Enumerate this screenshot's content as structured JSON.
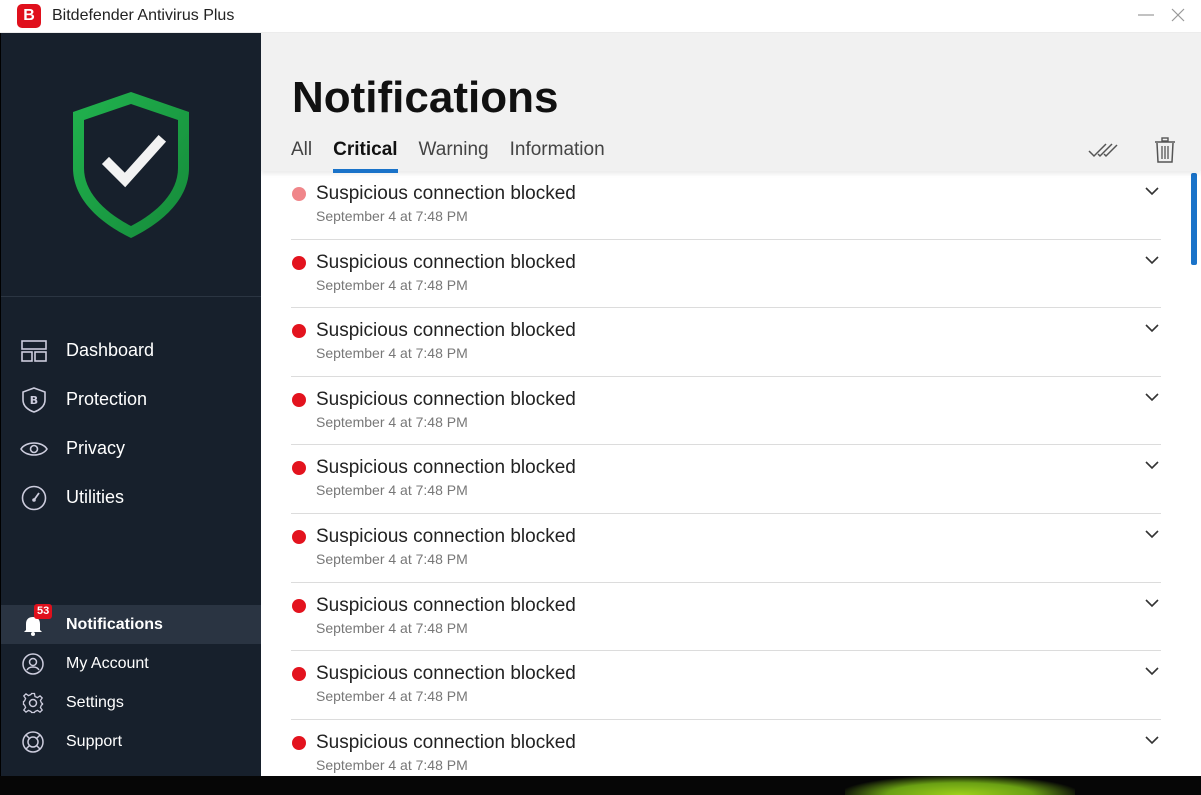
{
  "window": {
    "title": "Bitdefender Antivirus Plus",
    "logo_letter": "B",
    "minimize": "—",
    "close": "✕"
  },
  "sidebar": {
    "main_nav": [
      {
        "label": "Dashboard",
        "icon": "dashboard-icon"
      },
      {
        "label": "Protection",
        "icon": "shield-b-icon"
      },
      {
        "label": "Privacy",
        "icon": "eye-icon"
      },
      {
        "label": "Utilities",
        "icon": "gauge-icon"
      }
    ],
    "secondary_nav": [
      {
        "label": "Notifications",
        "icon": "bell-icon",
        "badge": "53",
        "active": true
      },
      {
        "label": "My Account",
        "icon": "user-icon"
      },
      {
        "label": "Settings",
        "icon": "gear-icon"
      },
      {
        "label": "Support",
        "icon": "lifebuoy-icon"
      }
    ]
  },
  "main": {
    "title": "Notifications",
    "tabs": [
      {
        "label": "All"
      },
      {
        "label": "Critical",
        "active": true
      },
      {
        "label": "Warning"
      },
      {
        "label": "Information"
      }
    ],
    "notifications": [
      {
        "title": "Suspicious connection blocked",
        "time": "September 4 at 7:48 PM",
        "read": true
      },
      {
        "title": "Suspicious connection blocked",
        "time": "September 4 at 7:48 PM"
      },
      {
        "title": "Suspicious connection blocked",
        "time": "September 4 at 7:48 PM"
      },
      {
        "title": "Suspicious connection blocked",
        "time": "September 4 at 7:48 PM"
      },
      {
        "title": "Suspicious connection blocked",
        "time": "September 4 at 7:48 PM"
      },
      {
        "title": "Suspicious connection blocked",
        "time": "September 4 at 7:48 PM"
      },
      {
        "title": "Suspicious connection blocked",
        "time": "September 4 at 7:48 PM"
      },
      {
        "title": "Suspicious connection blocked",
        "time": "September 4 at 7:48 PM"
      },
      {
        "title": "Suspicious connection blocked",
        "time": "September 4 at 7:48 PM"
      }
    ]
  },
  "colors": {
    "accent": "#1a73c9",
    "critical": "#e3131e",
    "sidebar": "#17202c",
    "shield": "#1faa4a"
  }
}
